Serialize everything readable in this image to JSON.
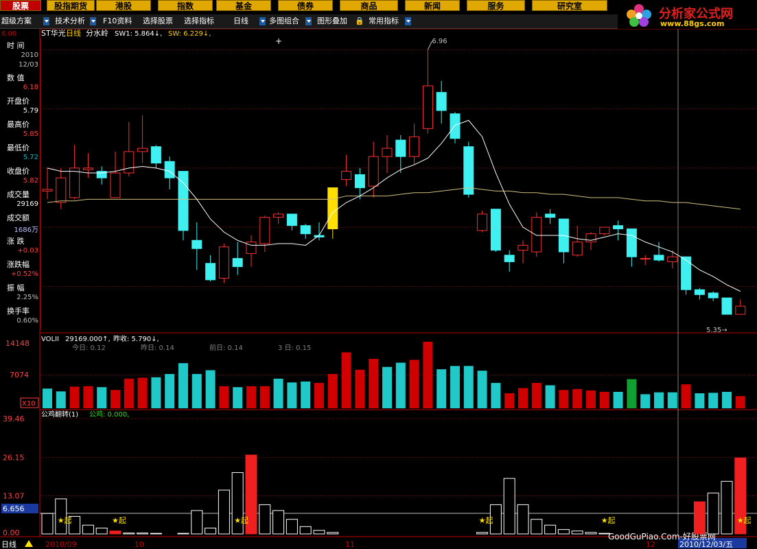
{
  "top_tabs": [
    "股票",
    "股指期货",
    "港股",
    "指数",
    "基金",
    "债券",
    "商品",
    "新闻",
    "服务",
    "研究室"
  ],
  "logo": {
    "title": "分析家公式网",
    "url": "www.88gs.com"
  },
  "toolbar": [
    "超级方案",
    "技术分析",
    "F10资料",
    "选择股票",
    "选择指标",
    "日线",
    "多图组合",
    "图形叠加",
    "常用指标"
  ],
  "header": {
    "stock_name": "ST华光",
    "period": "日线",
    "indicator": "分水岭",
    "sw1": "SW1: 5.864↓,",
    "sw": "SW: 6.229↓,",
    "top_left_price": "6.06"
  },
  "side_panel": [
    {
      "label": "时  间",
      "values": [
        "2010",
        "12/03"
      ]
    },
    {
      "label": "数  值",
      "values": [
        "6.18"
      ]
    },
    {
      "label": "开盘价",
      "values": [
        "5.79"
      ]
    },
    {
      "label": "最高价",
      "values": [
        "5.85"
      ]
    },
    {
      "label": "最低价",
      "values": [
        "5.72"
      ]
    },
    {
      "label": "收盘价",
      "values": [
        "5.82"
      ]
    },
    {
      "label": "成交量",
      "values": [
        "29169"
      ]
    },
    {
      "label": "成交额",
      "values": [
        "1686万"
      ]
    },
    {
      "label": "涨  跌",
      "values": [
        "+0.03"
      ]
    },
    {
      "label": "涨跌幅",
      "values": [
        "+0.52%"
      ]
    },
    {
      "label": "振  幅",
      "values": [
        "2.25%"
      ]
    },
    {
      "label": "换手率",
      "values": [
        "0.60%"
      ]
    }
  ],
  "price_labels": {
    "high": "6.96",
    "low": "5.35"
  },
  "volume_panel": {
    "title": "VOLII",
    "current": "29169.000↑,",
    "prev_label": "昨收: 5.790↓,",
    "stats": [
      "今日: 0.12",
      "昨日: 0.14",
      "前日: 0.14",
      "3 日: 0.15"
    ],
    "y_labels": [
      "14148",
      "7074",
      "X10"
    ]
  },
  "indicator_panel": {
    "title": "公鸡翻转(1)",
    "value": "公鸡: 0.000,",
    "y_labels": [
      "39.46",
      "26.15",
      "13.07",
      "0.00"
    ],
    "current_value": "6.656",
    "marker": "★起"
  },
  "bottom_bar": {
    "period": "日线",
    "dates": [
      "2010/09",
      "10",
      "11",
      "12",
      "2010/12/03/五"
    ],
    "watermark": "GoodGuPiao.Com-好股票网"
  },
  "chart_data": {
    "type": "candlestick",
    "candles": [
      {
        "o": 6.1,
        "c": 6.11,
        "h": 6.24,
        "l": 6.05
      },
      {
        "o": 6.03,
        "c": 6.18,
        "h": 6.24,
        "l": 5.99
      },
      {
        "o": 6.06,
        "c": 6.24,
        "h": 6.38,
        "l": 6.05
      },
      {
        "o": 6.23,
        "c": 6.24,
        "h": 6.33,
        "l": 6.18
      },
      {
        "o": 6.22,
        "c": 6.18,
        "h": 6.25,
        "l": 6.14
      },
      {
        "o": 6.06,
        "c": 6.21,
        "h": 6.34,
        "l": 6.06
      },
      {
        "o": 6.21,
        "c": 6.34,
        "h": 6.52,
        "l": 6.19
      },
      {
        "o": 6.34,
        "c": 6.36,
        "h": 6.56,
        "l": 6.27
      },
      {
        "o": 6.37,
        "c": 6.27,
        "h": 6.38,
        "l": 6.24
      },
      {
        "o": 6.28,
        "c": 6.18,
        "h": 6.31,
        "l": 6.11
      },
      {
        "o": 6.22,
        "c": 5.86,
        "h": 6.22,
        "l": 5.8
      },
      {
        "o": 5.8,
        "c": 5.75,
        "h": 5.91,
        "l": 5.62
      },
      {
        "o": 5.66,
        "c": 5.56,
        "h": 5.71,
        "l": 5.55
      },
      {
        "o": 5.57,
        "c": 5.76,
        "h": 5.78,
        "l": 5.54
      },
      {
        "o": 5.69,
        "c": 5.64,
        "h": 5.79,
        "l": 5.59
      },
      {
        "o": 5.72,
        "c": 5.79,
        "h": 5.83,
        "l": 5.64
      },
      {
        "o": 5.78,
        "c": 5.94,
        "h": 5.95,
        "l": 5.73
      },
      {
        "o": 5.94,
        "c": 5.96,
        "h": 5.97,
        "l": 5.9
      },
      {
        "o": 5.96,
        "c": 5.89,
        "h": 5.96,
        "l": 5.86
      },
      {
        "o": 5.89,
        "c": 5.84,
        "h": 5.9,
        "l": 5.81
      },
      {
        "o": 5.83,
        "c": 5.82,
        "h": 5.91,
        "l": 5.8
      },
      {
        "o": 5.87,
        "c": 6.12,
        "h": 6.12,
        "l": 5.81
      },
      {
        "o": 6.17,
        "c": 6.22,
        "h": 6.32,
        "l": 6.13
      },
      {
        "o": 6.2,
        "c": 6.12,
        "h": 6.24,
        "l": 6.05
      },
      {
        "o": 6.13,
        "c": 6.31,
        "h": 6.4,
        "l": 6.06
      },
      {
        "o": 6.31,
        "c": 6.36,
        "h": 6.44,
        "l": 6.21
      },
      {
        "o": 6.41,
        "c": 6.31,
        "h": 6.44,
        "l": 6.21
      },
      {
        "o": 6.31,
        "c": 6.43,
        "h": 6.51,
        "l": 6.26
      },
      {
        "o": 6.48,
        "c": 6.74,
        "h": 6.96,
        "l": 6.45
      },
      {
        "o": 6.7,
        "c": 6.59,
        "h": 6.77,
        "l": 6.51
      },
      {
        "o": 6.57,
        "c": 6.42,
        "h": 6.58,
        "l": 6.39
      },
      {
        "o": 6.37,
        "c": 6.08,
        "h": 6.4,
        "l": 6.06
      },
      {
        "o": 5.86,
        "c": 5.96,
        "h": 5.98,
        "l": 5.85
      },
      {
        "o": 5.99,
        "c": 5.74,
        "h": 5.99,
        "l": 5.73
      },
      {
        "o": 5.71,
        "c": 5.67,
        "h": 5.74,
        "l": 5.61
      },
      {
        "o": 5.74,
        "c": 5.77,
        "h": 5.8,
        "l": 5.66
      },
      {
        "o": 5.73,
        "c": 5.94,
        "h": 5.97,
        "l": 5.7
      },
      {
        "o": 5.96,
        "c": 5.94,
        "h": 5.99,
        "l": 5.9
      },
      {
        "o": 5.93,
        "c": 5.73,
        "h": 5.93,
        "l": 5.66
      },
      {
        "o": 5.71,
        "c": 5.79,
        "h": 5.89,
        "l": 5.7
      },
      {
        "o": 5.79,
        "c": 5.84,
        "h": 5.85,
        "l": 5.74
      },
      {
        "o": 5.84,
        "c": 5.88,
        "h": 5.88,
        "l": 5.83
      },
      {
        "o": 5.89,
        "c": 5.87,
        "h": 5.92,
        "l": 5.8
      },
      {
        "o": 5.87,
        "c": 5.7,
        "h": 5.87,
        "l": 5.64
      },
      {
        "o": 5.69,
        "c": 5.69,
        "h": 5.71,
        "l": 5.65
      },
      {
        "o": 5.71,
        "c": 5.68,
        "h": 5.79,
        "l": 5.67
      },
      {
        "o": 5.67,
        "c": 5.7,
        "h": 5.74,
        "l": 5.63
      },
      {
        "o": 5.7,
        "c": 5.5,
        "h": 5.7,
        "l": 5.47
      },
      {
        "o": 5.5,
        "c": 5.47,
        "h": 5.51,
        "l": 5.44
      },
      {
        "o": 5.48,
        "c": 5.45,
        "h": 5.49,
        "l": 5.43
      },
      {
        "o": 5.45,
        "c": 5.35,
        "h": 5.45,
        "l": 5.35
      },
      {
        "o": 5.35,
        "c": 5.4,
        "h": 5.44,
        "l": 5.35
      }
    ],
    "highlight_index": 21,
    "ma_white": [
      6.24,
      6.22,
      6.22,
      6.21,
      6.21,
      6.22,
      6.24,
      6.25,
      6.24,
      6.22,
      6.15,
      6.05,
      5.93,
      5.85,
      5.8,
      5.77,
      5.77,
      5.78,
      5.78,
      5.77,
      5.83,
      5.97,
      6.03,
      6.07,
      6.12,
      6.18,
      6.23,
      6.26,
      6.3,
      6.39,
      6.5,
      6.53,
      6.43,
      6.21,
      6.02,
      5.88,
      5.83,
      5.83,
      5.83,
      5.81,
      5.8,
      5.82,
      5.84,
      5.83,
      5.79,
      5.76,
      5.73,
      5.68,
      5.62,
      5.58,
      5.53,
      5.49
    ],
    "ma_yellow": [
      6.03,
      6.04,
      6.04,
      6.05,
      6.05,
      6.05,
      6.05,
      6.05,
      6.05,
      6.05,
      6.05,
      6.05,
      6.05,
      6.05,
      6.05,
      6.05,
      6.05,
      6.05,
      6.05,
      6.05,
      6.05,
      6.05,
      6.07,
      6.07,
      6.07,
      6.07,
      6.08,
      6.09,
      6.09,
      6.1,
      6.11,
      6.12,
      6.11,
      6.1,
      6.1,
      6.09,
      6.09,
      6.08,
      6.08,
      6.07,
      6.06,
      6.06,
      6.06,
      6.05,
      6.04,
      6.04,
      6.03,
      6.03,
      6.02,
      6.01,
      6.0,
      5.99
    ],
    "volume": [
      4200,
      3600,
      4600,
      4700,
      4500,
      3900,
      6300,
      6500,
      6600,
      7300,
      9600,
      7300,
      8100,
      4700,
      4500,
      4700,
      4700,
      6300,
      5500,
      5700,
      5400,
      7300,
      11900,
      8200,
      10500,
      8800,
      9700,
      10300,
      14148,
      8300,
      9000,
      9000,
      8000,
      5400,
      3200,
      4300,
      5400,
      4900,
      3900,
      4100,
      3800,
      3500,
      3500,
      6200,
      3000,
      3400,
      3400,
      5100,
      3200,
      3300,
      3500,
      2600
    ],
    "volume_color": [
      "c",
      "c",
      "r",
      "r",
      "c",
      "r",
      "r",
      "r",
      "c",
      "c",
      "c",
      "c",
      "c",
      "r",
      "c",
      "r",
      "r",
      "c",
      "c",
      "c",
      "r",
      "r",
      "r",
      "r",
      "r",
      "c",
      "c",
      "r",
      "r",
      "c",
      "c",
      "c",
      "c",
      "c",
      "r",
      "r",
      "r",
      "c",
      "r",
      "r",
      "r",
      "r",
      "c",
      "g",
      "c",
      "c",
      "c",
      "r",
      "c",
      "c",
      "c",
      "r"
    ],
    "indicator": [
      7,
      12,
      6,
      3,
      2,
      1,
      0.3,
      0.3,
      0.2,
      0,
      0.2,
      8,
      2,
      15,
      21,
      27,
      10,
      8,
      5,
      2.5,
      1.2,
      0.5,
      0,
      0,
      0,
      0,
      0,
      0,
      0,
      0,
      0,
      0,
      0.5,
      10,
      19,
      10,
      5,
      3,
      1.5,
      1,
      0.5,
      0.2,
      0,
      0,
      0,
      0,
      0,
      0,
      11,
      14,
      18,
      26,
      39.46
    ],
    "indicator_filled": [
      5,
      15,
      27,
      48,
      51
    ],
    "stars": [
      1,
      5,
      14,
      32,
      41,
      51
    ]
  }
}
